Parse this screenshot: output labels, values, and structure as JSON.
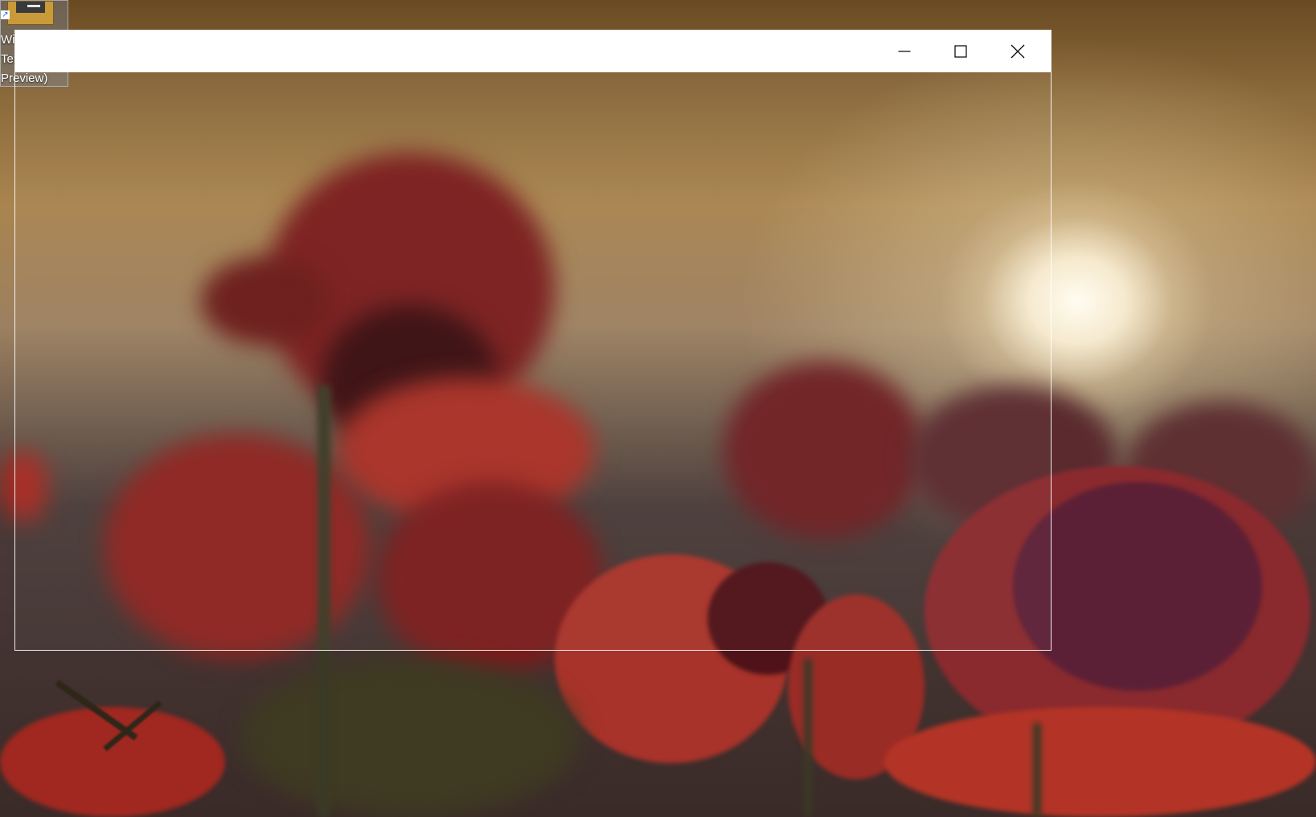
{
  "desktop": {
    "wallpaper": "red-poppies-at-sunset",
    "icon": {
      "label_lines": [
        "Wi",
        "Ter",
        "Preview)"
      ],
      "icon_name": "terminal-app-icon",
      "shortcut_overlay": "shortcut-arrow-icon"
    }
  },
  "window": {
    "title": "",
    "controls": {
      "minimize_icon": "minimize-icon",
      "maximize_icon": "maximize-icon",
      "close_icon": "close-icon"
    }
  },
  "colors": {
    "title_bar": "#ffffff",
    "window_border": "#ffffff",
    "icon_accent": "#c99a3a"
  }
}
